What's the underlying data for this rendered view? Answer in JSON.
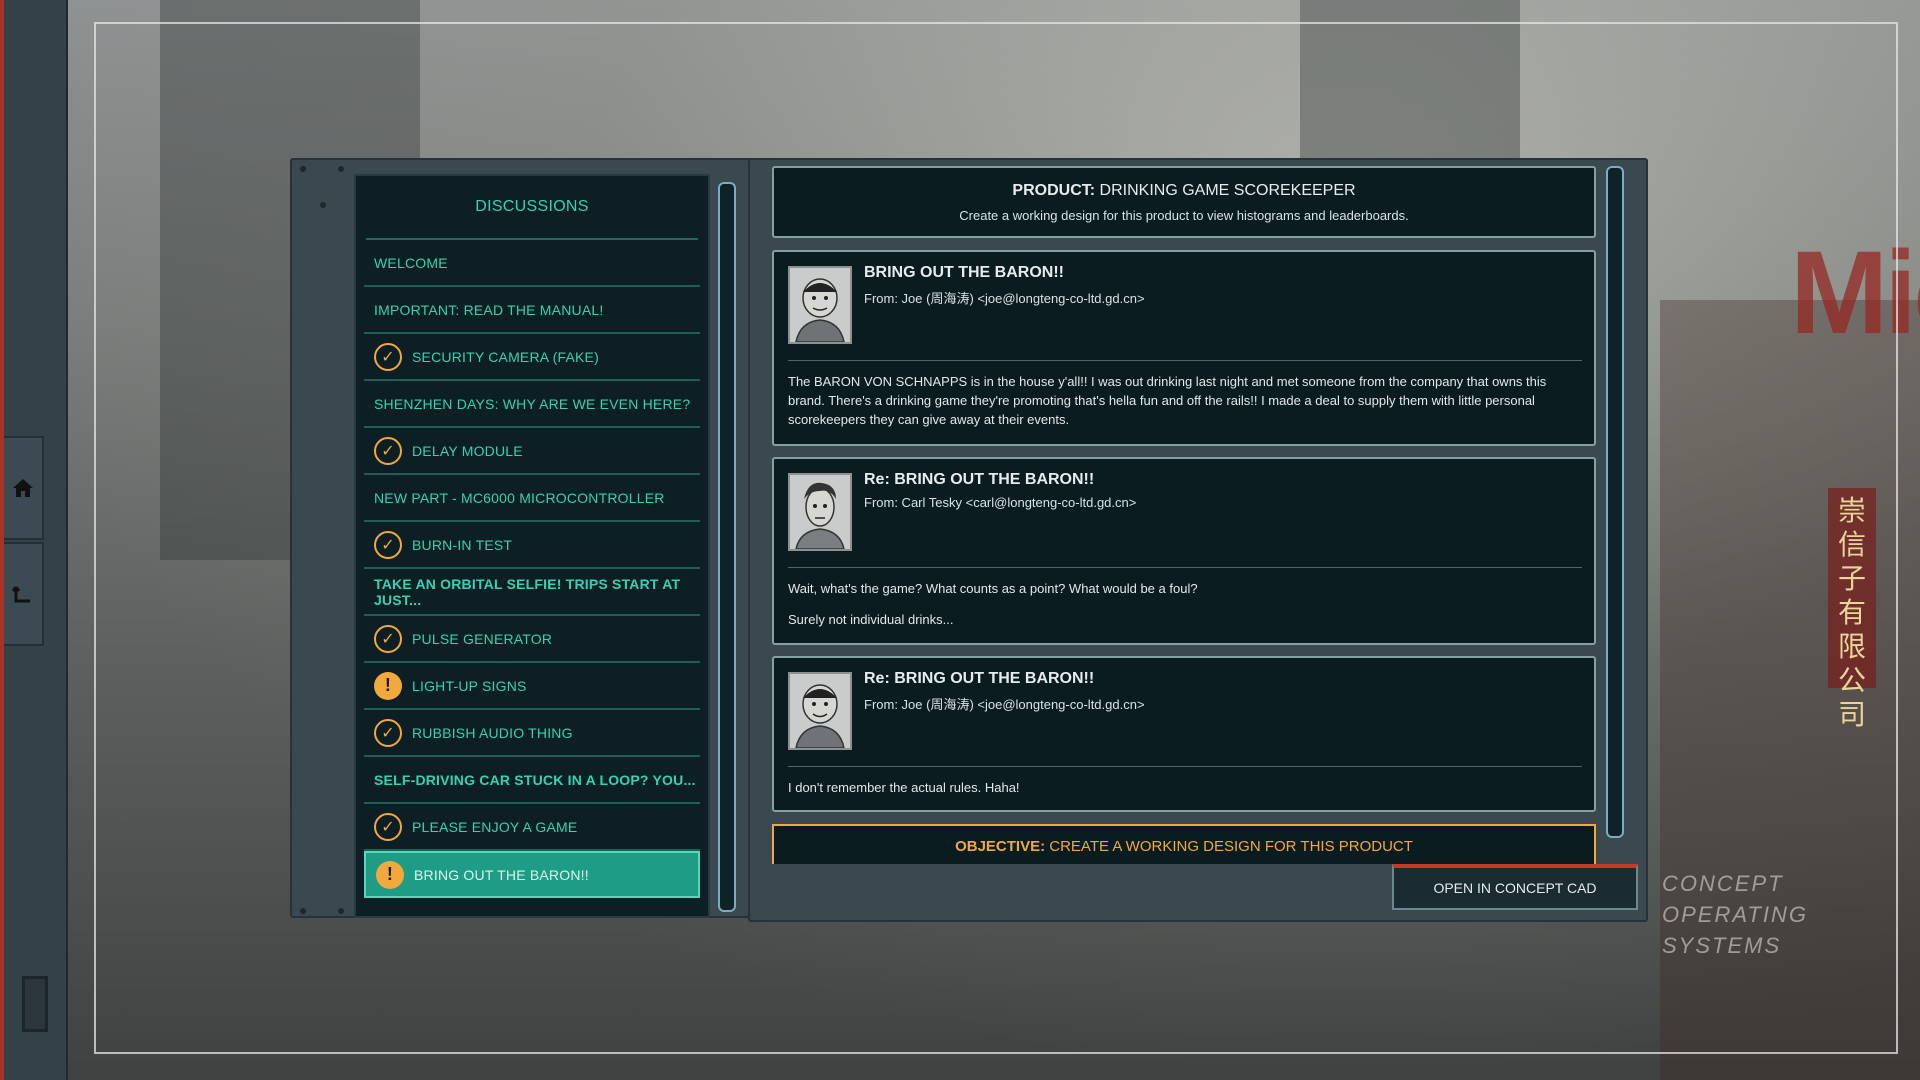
{
  "sidebar": {
    "home_icon": "home-icon",
    "back_icon": "back-icon"
  },
  "discussions": {
    "title": "DISCUSSIONS",
    "items": [
      {
        "label": "WELCOME",
        "status": "none",
        "bold": false
      },
      {
        "label": "IMPORTANT: READ THE MANUAL!",
        "status": "none",
        "bold": false
      },
      {
        "label": "SECURITY CAMERA (FAKE)",
        "status": "complete",
        "bold": false
      },
      {
        "label": "SHENZHEN DAYS: WHY ARE WE EVEN HERE?",
        "status": "none",
        "bold": false
      },
      {
        "label": "DELAY MODULE",
        "status": "complete",
        "bold": false
      },
      {
        "label": "NEW PART - MC6000 MICROCONTROLLER",
        "status": "none",
        "bold": false
      },
      {
        "label": "BURN-IN TEST",
        "status": "complete",
        "bold": false
      },
      {
        "label": "TAKE AN ORBITAL SELFIE! TRIPS START AT JUST...",
        "status": "none",
        "bold": true
      },
      {
        "label": "PULSE GENERATOR",
        "status": "complete",
        "bold": false
      },
      {
        "label": "LIGHT-UP SIGNS",
        "status": "incomplete",
        "bold": false
      },
      {
        "label": "RUBBISH AUDIO THING",
        "status": "complete",
        "bold": false
      },
      {
        "label": "SELF-DRIVING CAR STUCK IN A LOOP? YOU...",
        "status": "none",
        "bold": true
      },
      {
        "label": "PLEASE ENJOY A GAME",
        "status": "complete",
        "bold": false
      },
      {
        "label": "BRING OUT THE BARON!!",
        "status": "incomplete",
        "bold": false,
        "selected": true
      }
    ]
  },
  "product": {
    "prefix": "PRODUCT:",
    "name": "DRINKING GAME SCOREKEEPER",
    "subtitle": "Create a working design for this product to view histograms and leaderboards."
  },
  "messages": [
    {
      "subject": "BRING OUT THE BARON!!",
      "from": "From: Joe (周海涛) <joe@longteng-co-ltd.gd.cn>",
      "body": [
        "The BARON VON SCHNAPPS is in the house y'all!! I was out drinking last night and met someone from the company that owns this brand. There's a drinking game they're promoting that's hella fun and off the rails!! I made a deal to supply them with little personal scorekeepers they can give away at their events."
      ]
    },
    {
      "subject": "Re: BRING OUT THE BARON!!",
      "from": "From: Carl Tesky <carl@longteng-co-ltd.gd.cn>",
      "body": [
        "Wait, what's the game? What counts as a point? What would be a foul?",
        "Surely not individual drinks..."
      ]
    },
    {
      "subject": "Re: BRING OUT THE BARON!!",
      "from": "From: Joe (周海涛) <joe@longteng-co-ltd.gd.cn>",
      "body": [
        "I don't remember the actual rules. Haha!"
      ]
    }
  ],
  "objective": {
    "prefix": "OBJECTIVE:",
    "text": "CREATE A WORKING DESIGN FOR THIS PRODUCT"
  },
  "open_button": "OPEN IN CONCEPT CAD",
  "brand": {
    "line1": "CONCEPT",
    "line2": "OPERATING",
    "line3": "SYSTEMS"
  },
  "background_sign": {
    "text": "Mic",
    "vertical_text": "崇信子有限公司"
  },
  "colors": {
    "accent_teal": "#35d3b1",
    "accent_orange": "#f2a93b",
    "selected_bg": "#1e9c86",
    "button_red": "#c7372a"
  }
}
